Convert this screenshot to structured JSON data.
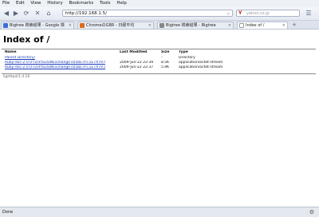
{
  "menu": [
    "File",
    "Edit",
    "View",
    "History",
    "Bookmarks",
    "Tools",
    "Help"
  ],
  "nav": {
    "back_glyph": "◀",
    "forward_glyph": "▶",
    "reload_glyph": "⟳",
    "stop_glyph": "✕",
    "home_glyph": "⌂",
    "url": "http://192.168.1.5/",
    "search_placeholder": "yahoo.co.jp"
  },
  "tabs": [
    {
      "label": "Bigtree 検索結果 - Google 検",
      "favicon_color": "#3a6ed6",
      "active": false
    },
    {
      "label": "ChromeのGBR - 日経平均",
      "favicon_color": "#e06a1b",
      "active": false
    },
    {
      "label": "Bigtree 検索結果 - Bigtree",
      "favicon_color": "#888888",
      "active": false
    },
    {
      "label": "Index of /",
      "favicon_color": "#ffffff",
      "active": true
    }
  ],
  "page": {
    "title": "Index of /",
    "columns": [
      "Name",
      "Last Modified",
      "Size",
      "Type"
    ],
    "rows": [
      {
        "name": "Parent Directory/",
        "modified": "",
        "size": "-",
        "type": "Directory"
      },
      {
        "name": "Ruby-doc-2.0.0-r2sFtSuSWExchange7D5bE7FC1E7X79.html",
        "modified": "2009-Jun-22 22:39",
        "size": "8.5K",
        "type": "application/octet-stream"
      },
      {
        "name": "Ruby-doc-2.0.0-r2sFtSuSWExchange7D5bE7FC1E7X79.zip",
        "modified": "2009-Jun-22 22:37",
        "size": "5.9K",
        "type": "application/octet-stream"
      }
    ],
    "footer": "lighttpd/1.4.19"
  },
  "status": {
    "text": "Done"
  }
}
